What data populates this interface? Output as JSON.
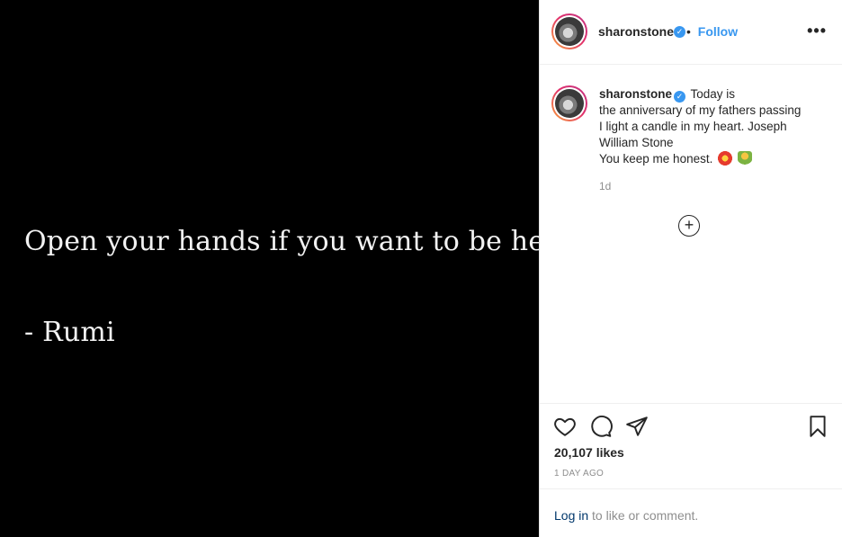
{
  "post": {
    "quote_line_1": "Open your hands if you want to be held.",
    "quote_line_2": "- Rumi"
  },
  "header": {
    "username": "sharonstone",
    "verified_icon": "verified-badge-icon",
    "dot": "•",
    "follow_label": "Follow",
    "more_label": "•••"
  },
  "caption": {
    "username": "sharonstone",
    "text_1": "Today is",
    "text_2": "the anniversary of my fathers passing",
    "text_3": "I light a candle in my heart. Joseph",
    "text_4": "William Stone",
    "text_5": "You keep me honest.",
    "age": "1d"
  },
  "actions": {
    "likes": "20,107 likes",
    "time": "1 DAY AGO"
  },
  "login": {
    "link": "Log in",
    "rest": " to like or comment."
  },
  "colors": {
    "accent": "#3897f0",
    "media_bg": "#000000",
    "secondary_text": "#8e8e8e"
  }
}
